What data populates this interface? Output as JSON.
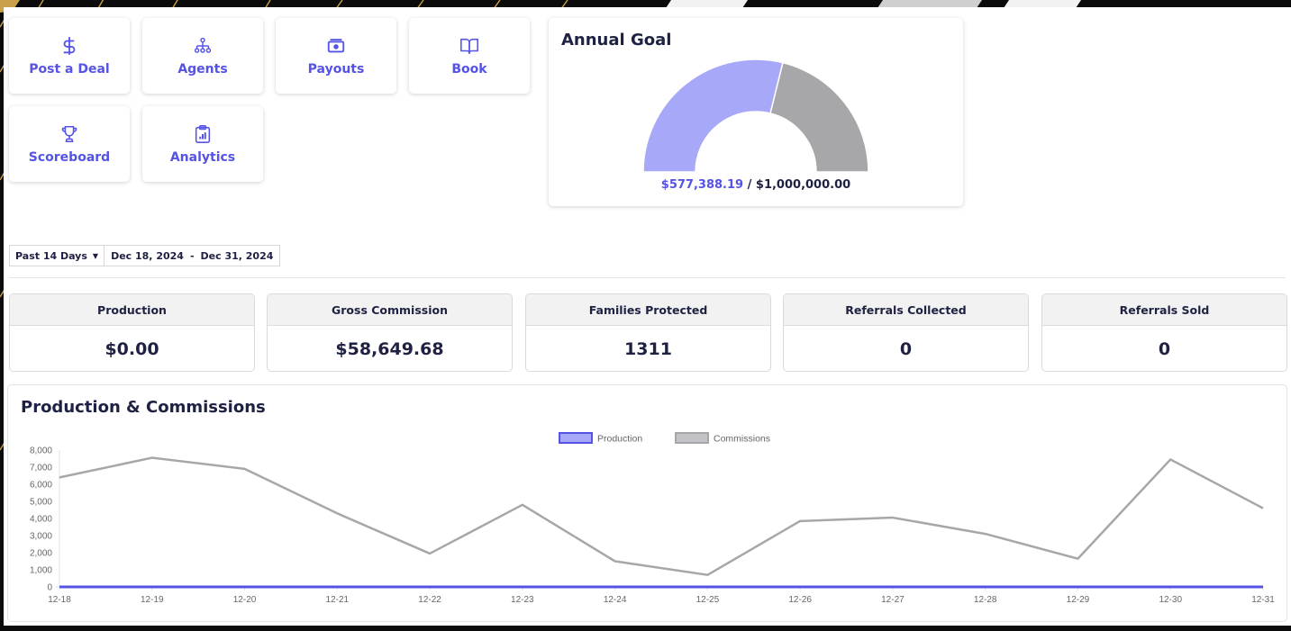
{
  "colors": {
    "accent": "#5553e6",
    "production_fill": "#a7a8f8",
    "commissions": "#a7a6a9",
    "dark_text": "#1e2142",
    "background_gold": "#c9a14a"
  },
  "shortcuts": [
    {
      "label": "Post a Deal",
      "icon": "dollar-icon"
    },
    {
      "label": "Agents",
      "icon": "org-chart-icon"
    },
    {
      "label": "Payouts",
      "icon": "cash-icon"
    },
    {
      "label": "Book",
      "icon": "book-icon"
    },
    {
      "label": "Scoreboard",
      "icon": "trophy-icon"
    },
    {
      "label": "Analytics",
      "icon": "clipboard-chart-icon"
    }
  ],
  "annual_goal": {
    "title": "Annual Goal",
    "current": "$577,388.19",
    "separator": " / ",
    "target": "$1,000,000.00",
    "progress_fraction": 0.577
  },
  "date_range": {
    "preset": "Past 14 Days",
    "start": "Dec 18, 2024",
    "separator": "-",
    "end": "Dec 31, 2024"
  },
  "stats": [
    {
      "label": "Production",
      "value": "$0.00"
    },
    {
      "label": "Gross Commission",
      "value": "$58,649.68"
    },
    {
      "label": "Families Protected",
      "value": "1311"
    },
    {
      "label": "Referrals Collected",
      "value": "0"
    },
    {
      "label": "Referrals Sold",
      "value": "0"
    }
  ],
  "chart_title": "Production & Commissions",
  "chart_data": {
    "type": "line",
    "title": "Production & Commissions",
    "x": [
      "12-18",
      "12-19",
      "12-20",
      "12-21",
      "12-22",
      "12-23",
      "12-24",
      "12-25",
      "12-26",
      "12-27",
      "12-28",
      "12-29",
      "12-30",
      "12-31"
    ],
    "series": [
      {
        "name": "Production",
        "values": [
          0,
          0,
          0,
          0,
          0,
          0,
          0,
          0,
          0,
          0,
          0,
          0,
          0,
          0
        ]
      },
      {
        "name": "Commissions",
        "values": [
          6400,
          7550,
          6900,
          4300,
          1950,
          4800,
          1500,
          700,
          3850,
          4050,
          3100,
          1650,
          7450,
          4600
        ]
      }
    ],
    "ylim": [
      0,
      8000
    ],
    "yticks": [
      "0",
      "1,000",
      "2,000",
      "3,000",
      "4,000",
      "5,000",
      "6,000",
      "7,000",
      "8,000"
    ],
    "legend": "top-center",
    "grid": false
  }
}
